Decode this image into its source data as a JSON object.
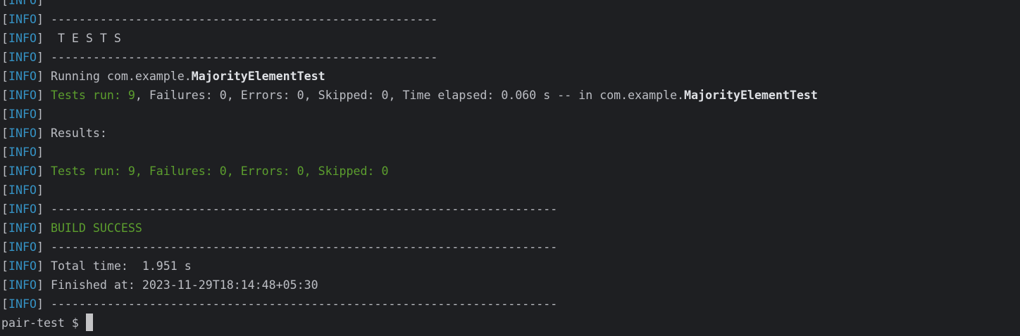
{
  "level": "INFO",
  "colors": {
    "background": "#1e1f22",
    "text": "#bcbec4",
    "info": "#3592c4",
    "success": "#5c9e2e"
  },
  "lines": [
    {
      "text": ""
    },
    {
      "text": "-------------------------------------------------------"
    },
    {
      "text": " T E S T S"
    },
    {
      "text": "-------------------------------------------------------"
    },
    {
      "text": "Running com.example.",
      "bold": "MajorityElementTest"
    },
    {
      "green": "Tests run: 9",
      "text": ", Failures: 0, Errors: 0, Skipped: 0, Time elapsed: 0.060 s -- in com.example.",
      "bold": "MajorityElementTest"
    },
    {
      "text": ""
    },
    {
      "text": "Results:"
    },
    {
      "text": ""
    },
    {
      "green": "Tests run: 9, Failures: 0, Errors: 0, Skipped: 0"
    },
    {
      "text": ""
    },
    {
      "text": "------------------------------------------------------------------------"
    },
    {
      "green": "BUILD SUCCESS"
    },
    {
      "text": "------------------------------------------------------------------------"
    },
    {
      "text": "Total time:  1.951 s"
    },
    {
      "text": "Finished at: 2023-11-29T18:14:48+05:30"
    },
    {
      "text": "------------------------------------------------------------------------"
    }
  ],
  "prompt": "pair-test $ "
}
